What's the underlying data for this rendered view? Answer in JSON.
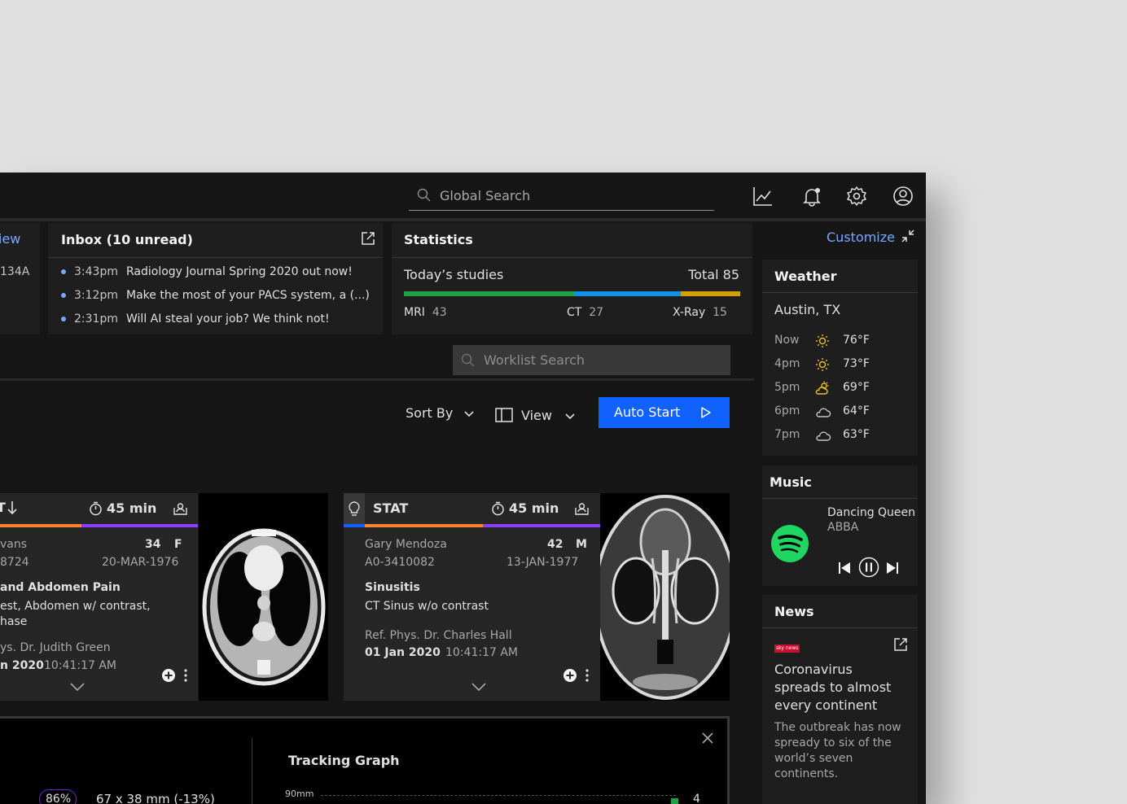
{
  "search": {
    "global_placeholder": "Global Search",
    "worklist_placeholder": "Worklist Search"
  },
  "left_tile": {
    "title_fragment": "iew",
    "value_fragment": "134A"
  },
  "inbox": {
    "title": "Inbox (10 unread)",
    "items": [
      {
        "time": "3:43pm",
        "text": "Radiology Journal Spring 2020 out now!"
      },
      {
        "time": "3:12pm",
        "text": "Make the most of your PACS system, a (...)"
      },
      {
        "time": "2:31pm",
        "text": "Will AI steal your job? We think not!"
      }
    ]
  },
  "statistics": {
    "title": "Statistics",
    "subtitle": "Today’s studies",
    "total_label": "Total 85",
    "mri_label": "MRI",
    "mri_value": "43",
    "ct_label": "CT",
    "ct_value": "27",
    "xray_label": "X-Ray",
    "xray_value": "15",
    "values": {
      "MRI": 43,
      "CT": 27,
      "X-Ray": 15
    },
    "colors": {
      "MRI": "#24a148",
      "CT": "#1192e8",
      "X-Ray": "#d2a106"
    }
  },
  "toolbar": {
    "sort_label": "Sort By",
    "view_label": "View",
    "auto_start_label": "Auto Start"
  },
  "cases": [
    {
      "priority": "T",
      "time": "45 min",
      "name": "vans",
      "id": "8724",
      "age": "34",
      "sex": "F",
      "dob": "20-MAR-1976",
      "title": "and Abdomen Pain",
      "desc1": "est, Abdomen w/ contrast,",
      "desc2": "hase",
      "ref": "ys. Dr. Judith Green",
      "date": "n 2020",
      "timestamp": "10:41:17 AM"
    },
    {
      "priority": "STAT",
      "time": "45 min",
      "name": "Gary Mendoza",
      "id": "A0-3410082",
      "age": "42",
      "sex": "M",
      "dob": "13-JAN-1977",
      "title": "Sinusitis",
      "desc1": "CT Sinus w/o contrast",
      "ref": "Ref. Phys. Dr. Charles Hall",
      "date": "01 Jan 2020",
      "timestamp": "10:41:17 AM"
    }
  ],
  "tracking": {
    "title": "Tracking Graph",
    "badge": "86%",
    "measure": "67 x 38 mm (-13%)",
    "y_tick": "90mm",
    "count": "4"
  },
  "customize": {
    "label": "Customize"
  },
  "weather": {
    "title": "Weather",
    "location": "Austin, TX",
    "rows": [
      {
        "time": "Now",
        "icon": "sun-icon",
        "temp": "76°F"
      },
      {
        "time": "4pm",
        "icon": "sun-icon",
        "temp": "73°F"
      },
      {
        "time": "5pm",
        "icon": "partly-cloudy-icon",
        "temp": "69°F"
      },
      {
        "time": "6pm",
        "icon": "cloud-icon",
        "temp": "64°F"
      },
      {
        "time": "7pm",
        "icon": "cloud-icon",
        "temp": "63°F"
      }
    ]
  },
  "music": {
    "title": "Music",
    "song": "Dancing Queen",
    "artist": "ABBA"
  },
  "news": {
    "title": "News",
    "source_logo": "sky news",
    "headline1": "Coronavirus",
    "headline2": "spreads to almost",
    "headline3": "every continent",
    "body1": "The outbreak has now",
    "body2": "spready to six of the",
    "body3": "world’s seven",
    "body4": "continents."
  }
}
